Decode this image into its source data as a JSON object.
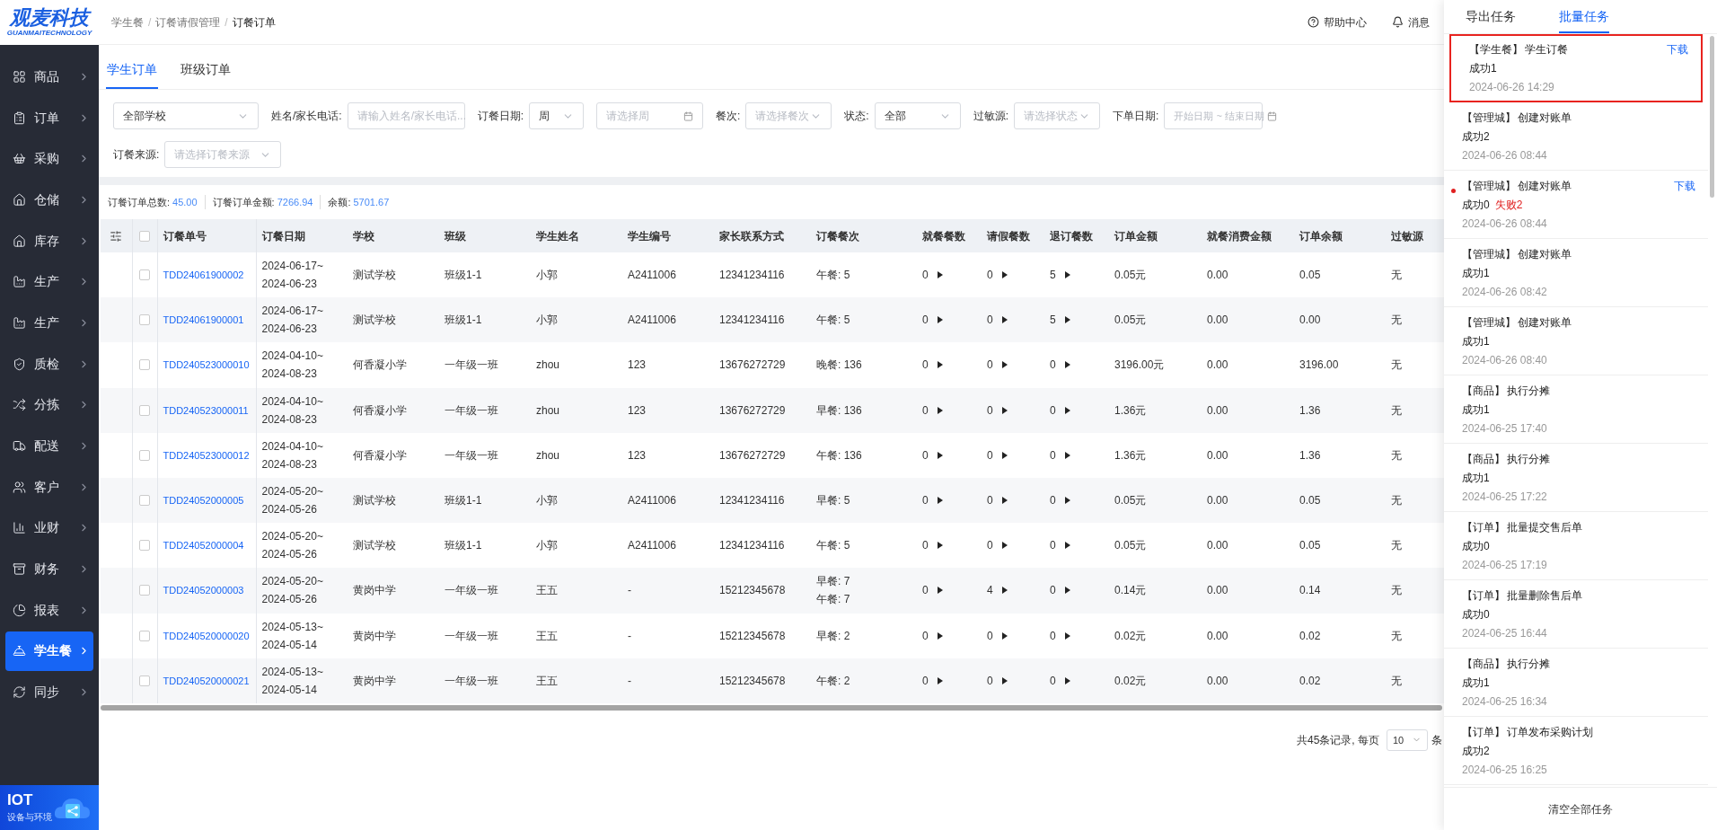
{
  "logo": {
    "name": "观麦科技",
    "subtitle": "GUANMAITECHNOLOGY"
  },
  "sidebar": {
    "items": [
      {
        "label": "商品",
        "selected": false
      },
      {
        "label": "订单",
        "selected": false
      },
      {
        "label": "采购",
        "selected": false
      },
      {
        "label": "仓储",
        "selected": false
      },
      {
        "label": "库存",
        "selected": false
      },
      {
        "label": "生产",
        "selected": false
      },
      {
        "label": "生产",
        "selected": false
      },
      {
        "label": "质检",
        "selected": false
      },
      {
        "label": "分拣",
        "selected": false
      },
      {
        "label": "配送",
        "selected": false
      },
      {
        "label": "客户",
        "selected": false
      },
      {
        "label": "业财",
        "selected": false
      },
      {
        "label": "财务",
        "selected": false
      },
      {
        "label": "报表",
        "selected": false
      },
      {
        "label": "学生餐",
        "selected": true
      },
      {
        "label": "同步",
        "selected": false
      }
    ],
    "banner": {
      "title": "IOT",
      "subtitle": "设备与环境"
    }
  },
  "breadcrumb": {
    "separator": "/",
    "items": [
      "学生餐",
      "订餐请假管理",
      "订餐订单"
    ]
  },
  "header_actions": [
    {
      "kind": "help",
      "label": "帮助中心"
    },
    {
      "kind": "bell",
      "label": "消息"
    }
  ],
  "tabs": [
    {
      "label": "学生订单",
      "selected": true
    },
    {
      "label": "班级订单",
      "selected": false
    }
  ],
  "filter_rows": [
    [
      {
        "kind": "select",
        "value": "全部学校"
      },
      {
        "kind": "input",
        "label": "姓名/家长电话:",
        "placeholder": "请输入姓名/家长电话..."
      },
      {
        "kind": "select",
        "label": "订餐日期:",
        "value": "周"
      },
      {
        "kind": "date",
        "placeholder": "请选择周"
      },
      {
        "kind": "select",
        "label": "餐次:",
        "placeholder": "请选择餐次"
      },
      {
        "kind": "select",
        "label": "状态:",
        "value": "全部"
      },
      {
        "kind": "select",
        "label": "过敏源:",
        "placeholder": "请选择状态"
      },
      {
        "kind": "range",
        "label": "下单日期:",
        "placeholder": "开始日期 ~ 结束日期"
      }
    ],
    [
      {
        "kind": "select",
        "label": "订餐来源:",
        "placeholder": "请选择订餐来源"
      }
    ]
  ],
  "summary": [
    {
      "label": "订餐订单总数:",
      "value": "45.00"
    },
    {
      "label": "订餐订单金额:",
      "value": "7266.94"
    },
    {
      "label": "余额:",
      "value": "5701.67"
    }
  ],
  "table": {
    "select_all_checked": false,
    "columns": [
      "订餐单号",
      "订餐日期",
      "学校",
      "班级",
      "学生姓名",
      "学生编号",
      "家长联系方式",
      "订餐餐次",
      "就餐餐数",
      "请假餐数",
      "退订餐数",
      "订单金额",
      "就餐消费金额",
      "订单余额",
      "过敏源"
    ],
    "rows": [
      {
        "checked": false,
        "id": "TDD24061900002",
        "date": [
          "2024-06-17~",
          "2024-06-23"
        ],
        "school": "测试学校",
        "class": "班级1-1",
        "name": "小郭",
        "student_no": "A2411006",
        "phone": "12341234116",
        "meals": [
          "午餐: 5"
        ],
        "dine": "0",
        "leave": "0",
        "cancel": "5",
        "amount": "0.05元",
        "spend": "0.00",
        "balance": "0.05",
        "allergen": "无"
      },
      {
        "checked": false,
        "id": "TDD24061900001",
        "date": [
          "2024-06-17~",
          "2024-06-23"
        ],
        "school": "测试学校",
        "class": "班级1-1",
        "name": "小郭",
        "student_no": "A2411006",
        "phone": "12341234116",
        "meals": [
          "午餐: 5"
        ],
        "dine": "0",
        "leave": "0",
        "cancel": "5",
        "amount": "0.05元",
        "spend": "0.00",
        "balance": "0.00",
        "allergen": "无"
      },
      {
        "checked": false,
        "id": "TDD240523000010",
        "date": [
          "2024-04-10~",
          "2024-08-23"
        ],
        "school": "何香凝小学",
        "class": "一年级一班",
        "name": "zhou",
        "student_no": "123",
        "phone": "13676272729",
        "meals": [
          "晚餐: 136"
        ],
        "dine": "0",
        "leave": "0",
        "cancel": "0",
        "amount": "3196.00元",
        "spend": "0.00",
        "balance": "3196.00",
        "allergen": "无"
      },
      {
        "checked": false,
        "id": "TDD240523000011",
        "date": [
          "2024-04-10~",
          "2024-08-23"
        ],
        "school": "何香凝小学",
        "class": "一年级一班",
        "name": "zhou",
        "student_no": "123",
        "phone": "13676272729",
        "meals": [
          "早餐: 136"
        ],
        "dine": "0",
        "leave": "0",
        "cancel": "0",
        "amount": "1.36元",
        "spend": "0.00",
        "balance": "1.36",
        "allergen": "无"
      },
      {
        "checked": false,
        "id": "TDD240523000012",
        "date": [
          "2024-04-10~",
          "2024-08-23"
        ],
        "school": "何香凝小学",
        "class": "一年级一班",
        "name": "zhou",
        "student_no": "123",
        "phone": "13676272729",
        "meals": [
          "午餐: 136"
        ],
        "dine": "0",
        "leave": "0",
        "cancel": "0",
        "amount": "1.36元",
        "spend": "0.00",
        "balance": "1.36",
        "allergen": "无"
      },
      {
        "checked": false,
        "id": "TDD24052000005",
        "date": [
          "2024-05-20~",
          "2024-05-26"
        ],
        "school": "测试学校",
        "class": "班级1-1",
        "name": "小郭",
        "student_no": "A2411006",
        "phone": "12341234116",
        "meals": [
          "早餐: 5"
        ],
        "dine": "0",
        "leave": "0",
        "cancel": "0",
        "amount": "0.05元",
        "spend": "0.00",
        "balance": "0.05",
        "allergen": "无"
      },
      {
        "checked": false,
        "id": "TDD24052000004",
        "date": [
          "2024-05-20~",
          "2024-05-26"
        ],
        "school": "测试学校",
        "class": "班级1-1",
        "name": "小郭",
        "student_no": "A2411006",
        "phone": "12341234116",
        "meals": [
          "午餐: 5"
        ],
        "dine": "0",
        "leave": "0",
        "cancel": "0",
        "amount": "0.05元",
        "spend": "0.00",
        "balance": "0.05",
        "allergen": "无"
      },
      {
        "checked": false,
        "id": "TDD24052000003",
        "date": [
          "2024-05-20~",
          "2024-05-26"
        ],
        "school": "黄岗中学",
        "class": "一年级一班",
        "name": "王五",
        "student_no": "-",
        "phone": "15212345678",
        "meals": [
          "早餐: 7",
          "午餐: 7"
        ],
        "dine": "0",
        "leave": "4",
        "cancel": "0",
        "amount": "0.14元",
        "spend": "0.00",
        "balance": "0.14",
        "allergen": "无"
      },
      {
        "checked": false,
        "id": "TDD240520000020",
        "date": [
          "2024-05-13~",
          "2024-05-14"
        ],
        "school": "黄岗中学",
        "class": "一年级一班",
        "name": "王五",
        "student_no": "-",
        "phone": "15212345678",
        "meals": [
          "早餐: 2"
        ],
        "dine": "0",
        "leave": "0",
        "cancel": "0",
        "amount": "0.02元",
        "spend": "0.00",
        "balance": "0.02",
        "allergen": "无"
      },
      {
        "checked": false,
        "id": "TDD240520000021",
        "date": [
          "2024-05-13~",
          "2024-05-14"
        ],
        "school": "黄岗中学",
        "class": "一年级一班",
        "name": "王五",
        "student_no": "-",
        "phone": "15212345678",
        "meals": [
          "午餐: 2"
        ],
        "dine": "0",
        "leave": "0",
        "cancel": "0",
        "amount": "0.02元",
        "spend": "0.00",
        "balance": "0.02",
        "allergen": "无"
      }
    ]
  },
  "pagination": {
    "total": "共45条记录, 每页",
    "page_size": "10",
    "suffix": "条"
  },
  "task_panel": {
    "tabs": [
      {
        "label": "导出任务",
        "selected": false
      },
      {
        "label": "批量任务",
        "selected": true
      }
    ],
    "tasks": [
      {
        "tag": "【学生餐】",
        "title": "学生订餐",
        "success": "成功1",
        "time": "2024-06-26 14:29",
        "download": "下载",
        "unread": false,
        "highlighted": true
      },
      {
        "tag": "【管理城】",
        "title": "创建对账单",
        "success": "成功2",
        "time": "2024-06-26 08:44",
        "unread": false,
        "highlighted": false
      },
      {
        "tag": "【管理城】",
        "title": "创建对账单",
        "success": "成功0",
        "fail": "失败2",
        "time": "2024-06-26 08:44",
        "download": "下载",
        "unread": true,
        "highlighted": false
      },
      {
        "tag": "【管理城】",
        "title": "创建对账单",
        "success": "成功1",
        "time": "2024-06-26 08:42",
        "unread": false,
        "highlighted": false
      },
      {
        "tag": "【管理城】",
        "title": "创建对账单",
        "success": "成功1",
        "time": "2024-06-26 08:40",
        "unread": false,
        "highlighted": false
      },
      {
        "tag": "【商品】",
        "title": "执行分摊",
        "success": "成功1",
        "time": "2024-06-25 17:40",
        "unread": false,
        "highlighted": false
      },
      {
        "tag": "【商品】",
        "title": "执行分摊",
        "success": "成功1",
        "time": "2024-06-25 17:22",
        "unread": false,
        "highlighted": false
      },
      {
        "tag": "【订单】",
        "title": "批量提交售后单",
        "success": "成功0",
        "time": "2024-06-25 17:19",
        "unread": false,
        "highlighted": false
      },
      {
        "tag": "【订单】",
        "title": "批量删除售后单",
        "success": "成功0",
        "time": "2024-06-25 16:44",
        "unread": false,
        "highlighted": false
      },
      {
        "tag": "【商品】",
        "title": "执行分摊",
        "success": "成功1",
        "time": "2024-06-25 16:34",
        "unread": false,
        "highlighted": false
      },
      {
        "tag": "【订单】",
        "title": "订单发布采购计划",
        "success": "成功2",
        "time": "2024-06-25 16:25",
        "unread": false,
        "highlighted": false
      }
    ],
    "clear_button": "清空全部任务"
  }
}
